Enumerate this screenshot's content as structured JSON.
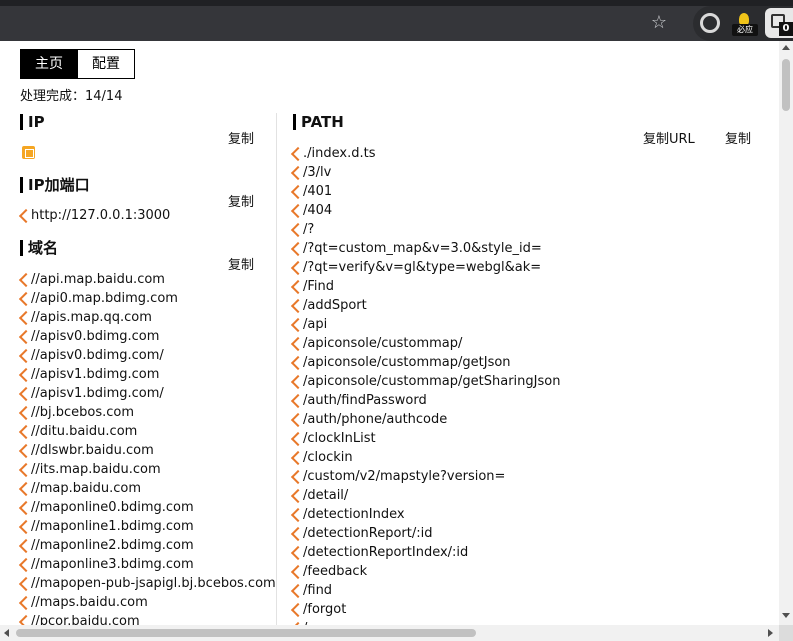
{
  "browser": {
    "biying_label": "必应",
    "ext_badge": "0"
  },
  "tabs": [
    {
      "label": "主页",
      "active": true
    },
    {
      "label": "配置",
      "active": false
    }
  ],
  "progress": "处理完成：14/14",
  "left": {
    "ip": {
      "title": "IP",
      "copy": "复制"
    },
    "ip_port": {
      "title": "IP加端口",
      "copy": "复制",
      "items": [
        "http://127.0.0.1:3000"
      ]
    },
    "domain": {
      "title": "域名",
      "copy": "复制",
      "items": [
        "//api.map.baidu.com",
        "//api0.map.bdimg.com",
        "//apis.map.qq.com",
        "//apisv0.bdimg.com",
        "//apisv0.bdimg.com/",
        "//apisv1.bdimg.com",
        "//apisv1.bdimg.com/",
        "//bj.bcebos.com",
        "//ditu.baidu.com",
        "//dlswbr.baidu.com",
        "//its.map.baidu.com",
        "//map.baidu.com",
        "//maponline0.bdimg.com",
        "//maponline1.bdimg.com",
        "//maponline2.bdimg.com",
        "//maponline3.bdimg.com",
        "//mapopen-pub-jsapigl.bj.bcebos.com",
        "//maps.baidu.com",
        "//pcor.baidu.com"
      ]
    }
  },
  "right": {
    "path": {
      "title": "PATH",
      "copy_url": "复制URL",
      "copy": "复制",
      "items": [
        "./index.d.ts",
        "/3/lv",
        "/401",
        "/404",
        "/?",
        "/?qt=custom_map&v=3.0&style_id=",
        "/?qt=verify&v=gl&type=webgl&ak=",
        "/Find",
        "/addSport",
        "/api",
        "/apiconsole/custommap/",
        "/apiconsole/custommap/getJson",
        "/apiconsole/custommap/getSharingJson",
        "/auth/findPassword",
        "/auth/phone/authcode",
        "/clockInList",
        "/clockin",
        "/custom/v2/mapstyle?version=",
        "/detail/",
        "/detectionIndex",
        "/detectionReport/:id",
        "/detectionReportIndex/:id",
        "/feedback",
        "/find",
        "/forgot",
        "/..."
      ]
    }
  },
  "colors": {
    "arrow": "#e8782a",
    "active_tab_bg": "#000000"
  }
}
